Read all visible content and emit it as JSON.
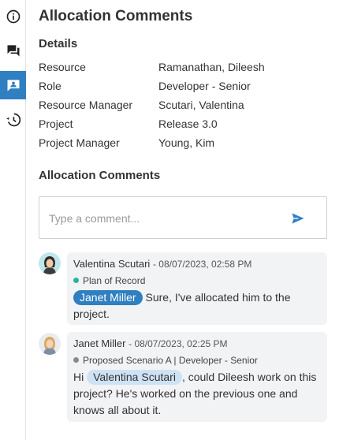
{
  "rail": {
    "items": [
      {
        "name": "info-icon",
        "active": false
      },
      {
        "name": "comments-icon",
        "active": false
      },
      {
        "name": "contact-card-icon",
        "active": true
      },
      {
        "name": "history-icon",
        "active": false
      }
    ],
    "accent": "#2f7fc1"
  },
  "page": {
    "title": "Allocation Comments"
  },
  "details": {
    "heading": "Details",
    "rows": [
      {
        "label": "Resource",
        "value": "Ramanathan, Dileesh"
      },
      {
        "label": "Role",
        "value": "Developer - Senior"
      },
      {
        "label": "Resource Manager",
        "value": "Scutari, Valentina"
      },
      {
        "label": "Project",
        "value": "Release 3.0"
      },
      {
        "label": "Project Manager",
        "value": "Young, Kim"
      }
    ]
  },
  "comments": {
    "heading": "Allocation Comments",
    "input": {
      "placeholder": "Type a comment...",
      "value": ""
    },
    "items": [
      {
        "author": "Valentina Scutari",
        "timestamp": "08/07/2023, 02:58 PM",
        "tag": "Plan of Record",
        "tag_color": "#26b5a0",
        "mention": "Janet Miller",
        "text": "Sure, I've allocated him to the project."
      },
      {
        "author": "Janet Miller",
        "timestamp": "08/07/2023, 02:25 PM",
        "tag": "Proposed Scenario A | Developer - Senior",
        "tag_color": "#8a8a8a",
        "prefix": "Hi",
        "mention": "Valentina Scutari",
        "text": ", could Dileesh work on this project? He's worked on the previous one and knows all about it."
      }
    ]
  }
}
